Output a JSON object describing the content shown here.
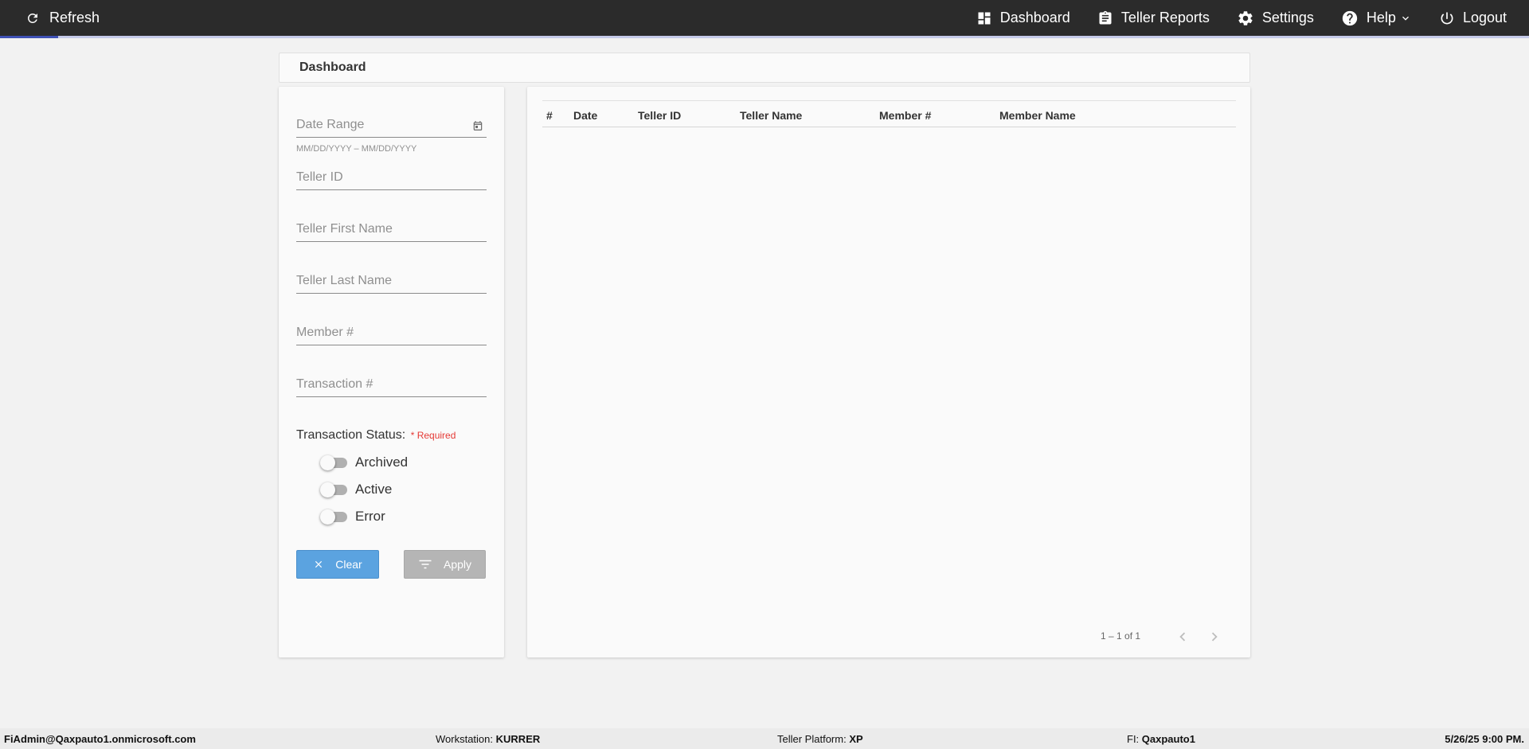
{
  "topbar": {
    "refresh_label": "Refresh",
    "progress_fraction": 0.038,
    "nav": [
      {
        "label": "Dashboard",
        "icon": "dashboard-icon"
      },
      {
        "label": "Teller Reports",
        "icon": "clipboard-icon"
      },
      {
        "label": "Settings",
        "icon": "gear-icon"
      },
      {
        "label": "Help",
        "icon": "help-circle-icon",
        "has_dropdown": true
      },
      {
        "label": "Logout",
        "icon": "power-icon"
      }
    ]
  },
  "page": {
    "title": "Dashboard"
  },
  "filters": {
    "date_range_placeholder": "Date Range",
    "date_hint": "MM/DD/YYYY – MM/DD/YYYY",
    "teller_id_placeholder": "Teller ID",
    "teller_first_name_placeholder": "Teller First Name",
    "teller_last_name_placeholder": "Teller Last Name",
    "member_placeholder": "Member #",
    "transaction_placeholder": "Transaction #",
    "status_label": "Transaction Status:",
    "required_label": "* Required",
    "statuses": [
      {
        "label": "Archived",
        "on": false
      },
      {
        "label": "Active",
        "on": false
      },
      {
        "label": "Error",
        "on": false
      }
    ],
    "clear_label": "Clear",
    "apply_label": "Apply"
  },
  "table": {
    "columns": [
      "#",
      "Date",
      "Teller ID",
      "Teller Name",
      "Member #",
      "Member Name"
    ],
    "rows": [],
    "paginator_range": "1 – 1 of 1"
  },
  "statusbar": {
    "user": "FiAdmin@Qaxpauto1.onmicrosoft.com",
    "workstation_label": "Workstation:",
    "workstation": "KURRER",
    "platform_label": "Teller Platform:",
    "platform": "XP",
    "fi_label": "FI:",
    "fi": "Qaxpauto1",
    "datetime": "5/26/25 9:00 PM."
  },
  "colors": {
    "topbar_bg": "#2b2b2b",
    "progress": "#3f51b5",
    "clear_button": "#5ba3e0",
    "apply_button_disabled": "#b5b5b5",
    "required": "#e53935"
  }
}
